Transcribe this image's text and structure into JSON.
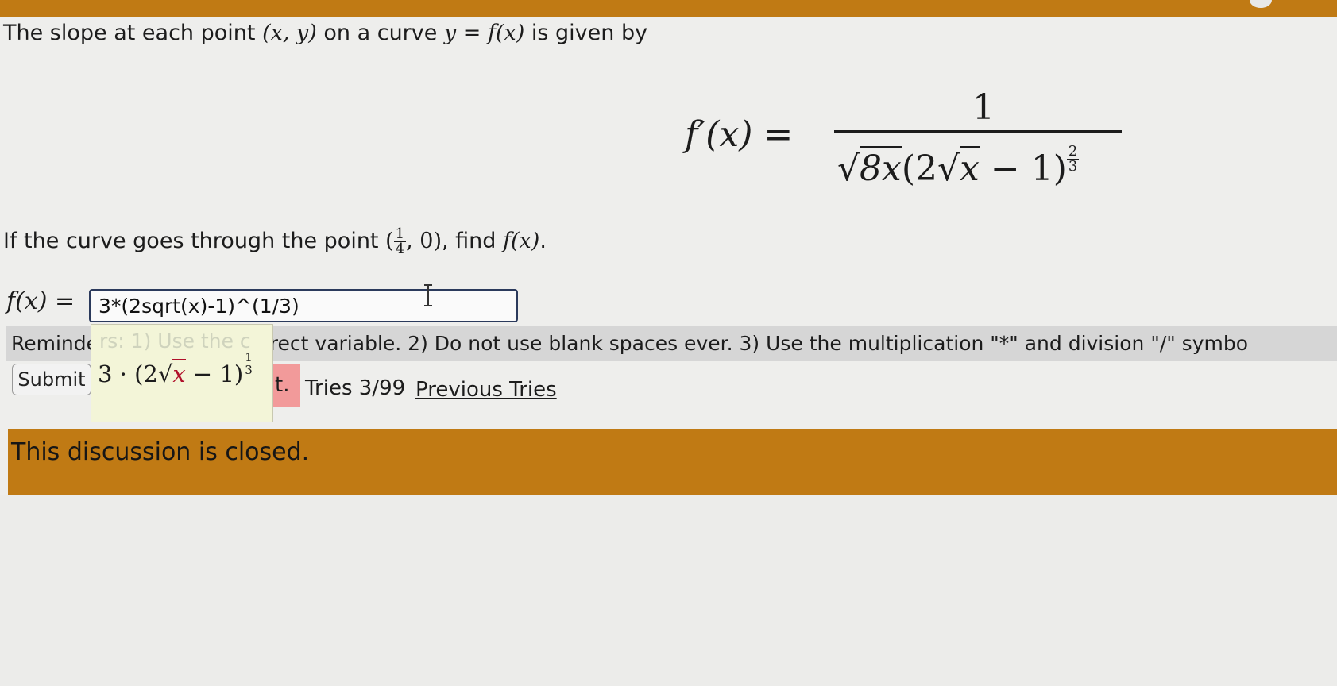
{
  "question": {
    "line1_before": "The slope at each point ",
    "line1_point": "(x, y)",
    "line1_mid": " on a curve ",
    "line1_curve": "y = f(x)",
    "line1_after": " is given by",
    "formula_lhs": "f′(x) =",
    "formula_num": "1",
    "formula_den_a": "8x",
    "formula_den_b": "(2",
    "formula_den_c": "x",
    "formula_den_d": " − 1)",
    "formula_exp_num": "2",
    "formula_exp_den": "3",
    "line2_before": "If the curve goes through the point ",
    "point_open": "(",
    "point_num": "1",
    "point_den": "4",
    "point_rest": ", 0)",
    "line2_mid": ", find ",
    "line2_f": "f(x)",
    "line2_after": "."
  },
  "answer": {
    "label": "f(x) =",
    "value": "3*(2sqrt(x)-1)^(1/3)"
  },
  "reminder": {
    "text": "Reminders: 1) Use the correct variable. 2) Do not use blank spaces ever. 3) Use the multiplication \"*\" and division \"/\" symbo"
  },
  "submit": {
    "label": "Submit"
  },
  "feedback": {
    "status": "Answer: Incorrect.",
    "visible": "t.",
    "tries": "Tries 3/99",
    "previous_tries": "Previous Tries"
  },
  "preview": {
    "ghost": "rs: 1) Use the c",
    "coef": "3 · (2",
    "var": "x",
    "rest": " − 1)",
    "exp_num": "1",
    "exp_den": "3"
  },
  "discussion": {
    "closed_text": "This discussion is closed."
  },
  "colors": {
    "banner": "#c07a14",
    "reminder_bg": "#d6d6d6",
    "input_border": "#2b3a5c",
    "incorrect_badge": "#f29a9a",
    "preview_bg": "#f3f5d8"
  }
}
